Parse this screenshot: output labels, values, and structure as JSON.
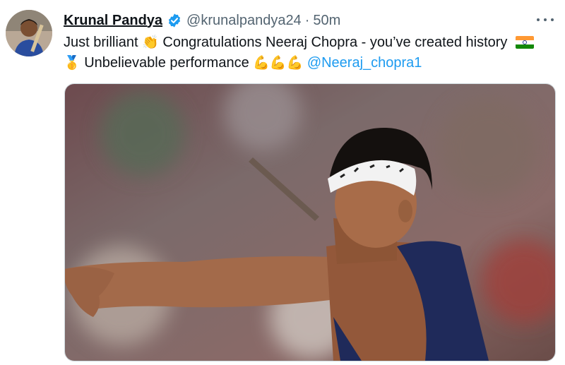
{
  "author": {
    "name": "Krunal Pandya",
    "handle": "@krunalpandya24",
    "separator": "·",
    "time": "50m"
  },
  "tweet": {
    "part1": "Just brilliant ",
    "clap_emoji": "👏",
    "part2": " Congratulations Neeraj Chopra - you’ve created history ",
    "medal_emoji": "🥇",
    "part3": " Unbelievable performance ",
    "muscle_emoji": "💪💪💪",
    "mention": "@Neeraj_chopra1"
  },
  "icons": {
    "verified": "verified-badge-icon",
    "more": "more-options-icon",
    "flag": "india-flag-icon"
  },
  "colors": {
    "link": "#1d9bf0",
    "verified": "#1d9bf0",
    "text": "#0f1419",
    "muted": "#536471"
  }
}
